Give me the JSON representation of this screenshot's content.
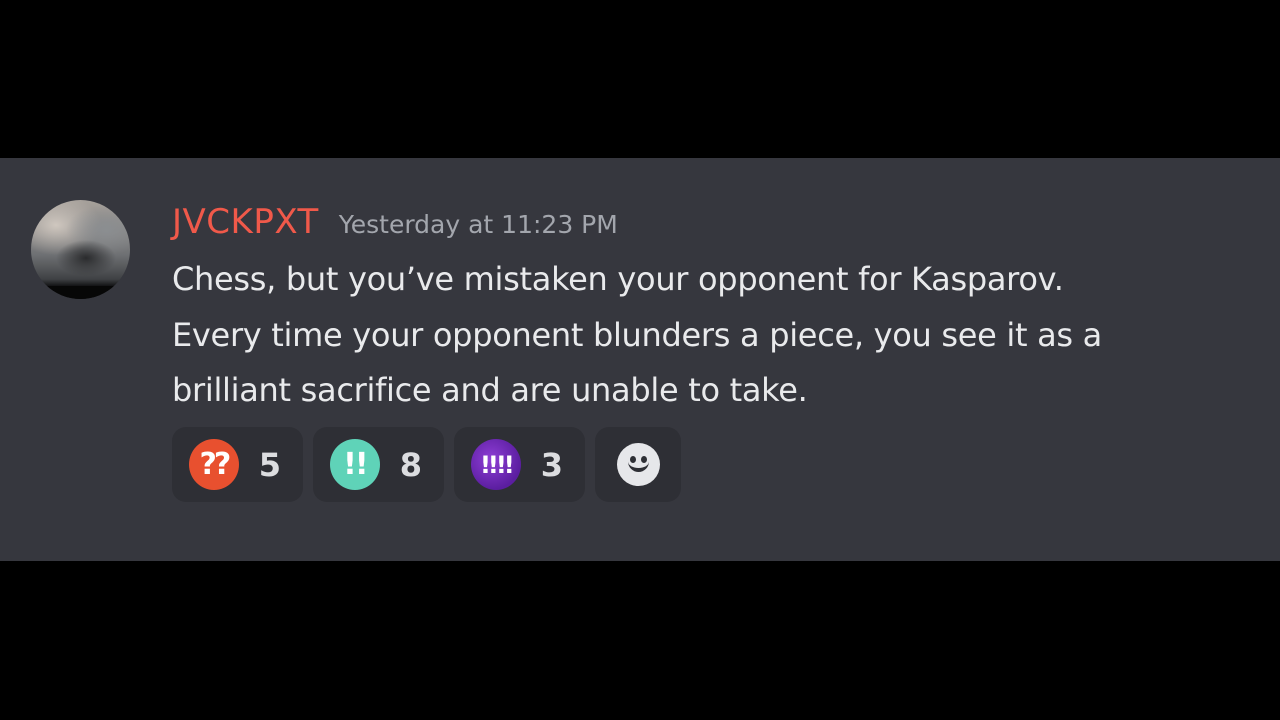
{
  "message": {
    "author": "JVCKPXT",
    "timestamp": "Yesterday at 11:23 PM",
    "lines": [
      "Chess, but you’ve mistaken your opponent for Kasparov.",
      "Every time your opponent blunders a piece, you see it as a",
      "brilliant sacrifice and are unable to take."
    ]
  },
  "reactions": [
    {
      "icon": "double-question-mark-icon",
      "glyph": "??",
      "count": "5",
      "color": "#e8502f"
    },
    {
      "icon": "double-exclamation-icon",
      "glyph": "!!",
      "count": "8",
      "color": "#5fd3b8"
    },
    {
      "icon": "quadruple-exclamation-icon",
      "glyph": "!!!!",
      "count": "3",
      "color": "#7b2fc4"
    }
  ],
  "add_reaction": {
    "icon": "smiley-face-icon"
  },
  "colors": {
    "background": "#000000",
    "panel": "#36373e",
    "username": "#f0594a",
    "timestamp": "#a3a6ad",
    "text": "#e9eaec",
    "reaction_bg": "#2e2f35"
  }
}
